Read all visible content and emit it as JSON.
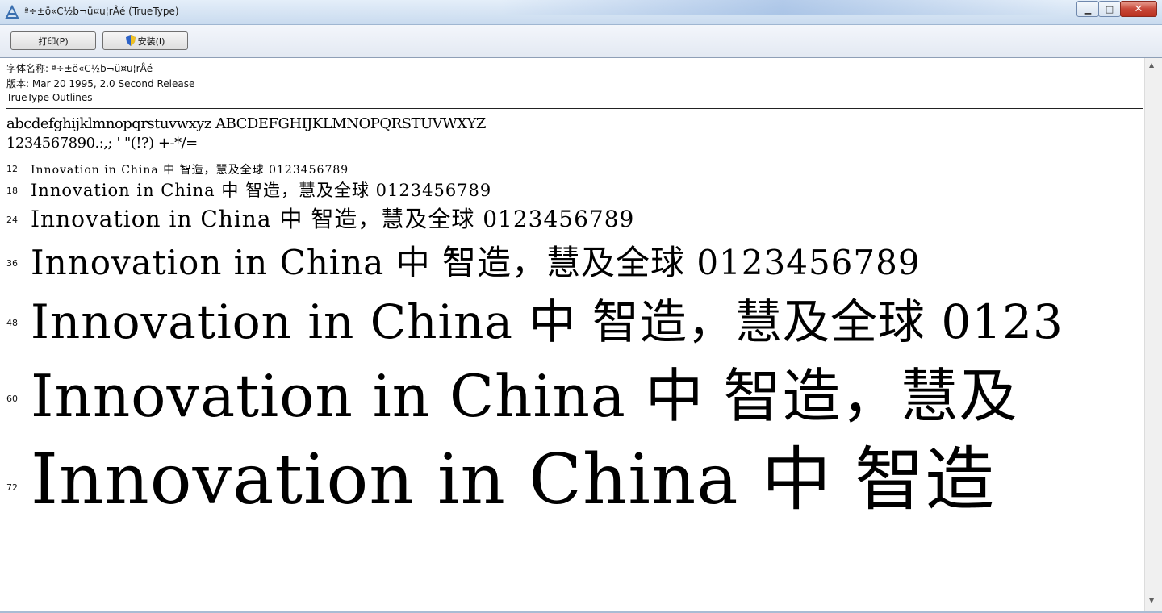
{
  "window": {
    "title": "ª÷±ö«C½b¬ü¤u¦rÅé (TrueType)",
    "buttons": {
      "minimize": "▁",
      "maximize": "□",
      "close": "✕"
    }
  },
  "toolbar": {
    "print_label": "打印(P)",
    "install_label": "安装(I)"
  },
  "font_info": {
    "name_line": "字体名称: ª÷±ö«C½b¬ü¤u¦rÅé",
    "version_line": "版本: Mar 20 1995, 2.0 Second Release",
    "type_line": "TrueType Outlines"
  },
  "charset": {
    "line1": "abcdefghijklmnopqrstuvwxyz ABCDEFGHIJKLMNOPQRSTUVWXYZ",
    "line2": "1234567890.:,; ' \"(!?) +-*/="
  },
  "samples": [
    {
      "size": "12",
      "text": "Innovation in China 中  智造，慧及全球 0123456789"
    },
    {
      "size": "18",
      "text": "Innovation in China 中  智造，慧及全球 0123456789"
    },
    {
      "size": "24",
      "text": "Innovation in China 中  智造，慧及全球 0123456789"
    },
    {
      "size": "36",
      "text": "Innovation in China 中  智造，慧及全球 0123456789"
    },
    {
      "size": "48",
      "text": "Innovation in China 中  智造，慧及全球 0123"
    },
    {
      "size": "60",
      "text": "Innovation in China 中  智造，慧及"
    },
    {
      "size": "72",
      "text": "Innovation in China 中  智造"
    }
  ],
  "scrollbar": {
    "up": "▲",
    "down": "▼"
  }
}
